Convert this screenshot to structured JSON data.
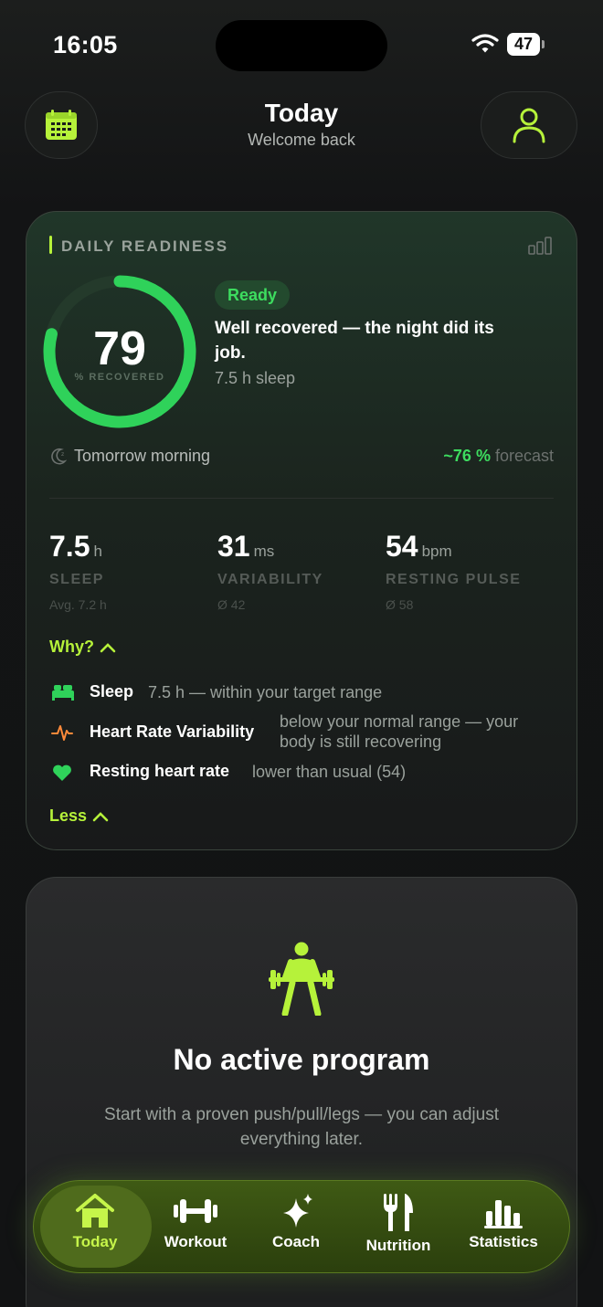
{
  "status_bar": {
    "time": "16:05",
    "battery": "47"
  },
  "header": {
    "title": "Today",
    "subtitle": "Welcome back"
  },
  "readiness": {
    "section_label": "DAILY READINESS",
    "score": "79",
    "score_fraction": 0.79,
    "score_label": "% RECOVERED",
    "badge": "Ready",
    "headline": "Well recovered — the night did its job.",
    "sleep_summary": "7.5 h sleep",
    "tomorrow_label": "Tomorrow morning",
    "forecast_value": "~76 %",
    "forecast_label": "forecast",
    "metrics": [
      {
        "value": "7.5",
        "unit": "h",
        "label": "SLEEP",
        "avg": "Avg. 7.2 h"
      },
      {
        "value": "31",
        "unit": "ms",
        "label": "VARIABILITY",
        "avg": "Ø 42"
      },
      {
        "value": "54",
        "unit": "bpm",
        "label": "RESTING PULSE",
        "avg": "Ø 58"
      }
    ],
    "why_label": "Why?",
    "reasons": [
      {
        "name": "Sleep",
        "desc": "7.5 h — within your target range",
        "icon": "bed-icon"
      },
      {
        "name": "Heart Rate Variability",
        "desc": "below your normal range — your body is still recovering",
        "icon": "pulse-icon"
      },
      {
        "name": "Resting heart rate",
        "desc": "lower than usual (54)",
        "icon": "heart-icon"
      }
    ],
    "less_label": "Less"
  },
  "program": {
    "title": "No active program",
    "description": "Start with a proven push/pull/legs — you can adjust everything later."
  },
  "tabs": [
    {
      "label": "Today",
      "icon": "home-icon",
      "active": true
    },
    {
      "label": "Workout",
      "icon": "dumbbell-icon",
      "active": false
    },
    {
      "label": "Coach",
      "icon": "sparkle-icon",
      "active": false
    },
    {
      "label": "Nutrition",
      "icon": "fork-knife-icon",
      "active": false
    },
    {
      "label": "Statistics",
      "icon": "bar-chart-icon",
      "active": false
    }
  ],
  "colors": {
    "accent": "#b6f23a",
    "ring": "#2fd25a",
    "tab_bar": "#3f5a14"
  }
}
